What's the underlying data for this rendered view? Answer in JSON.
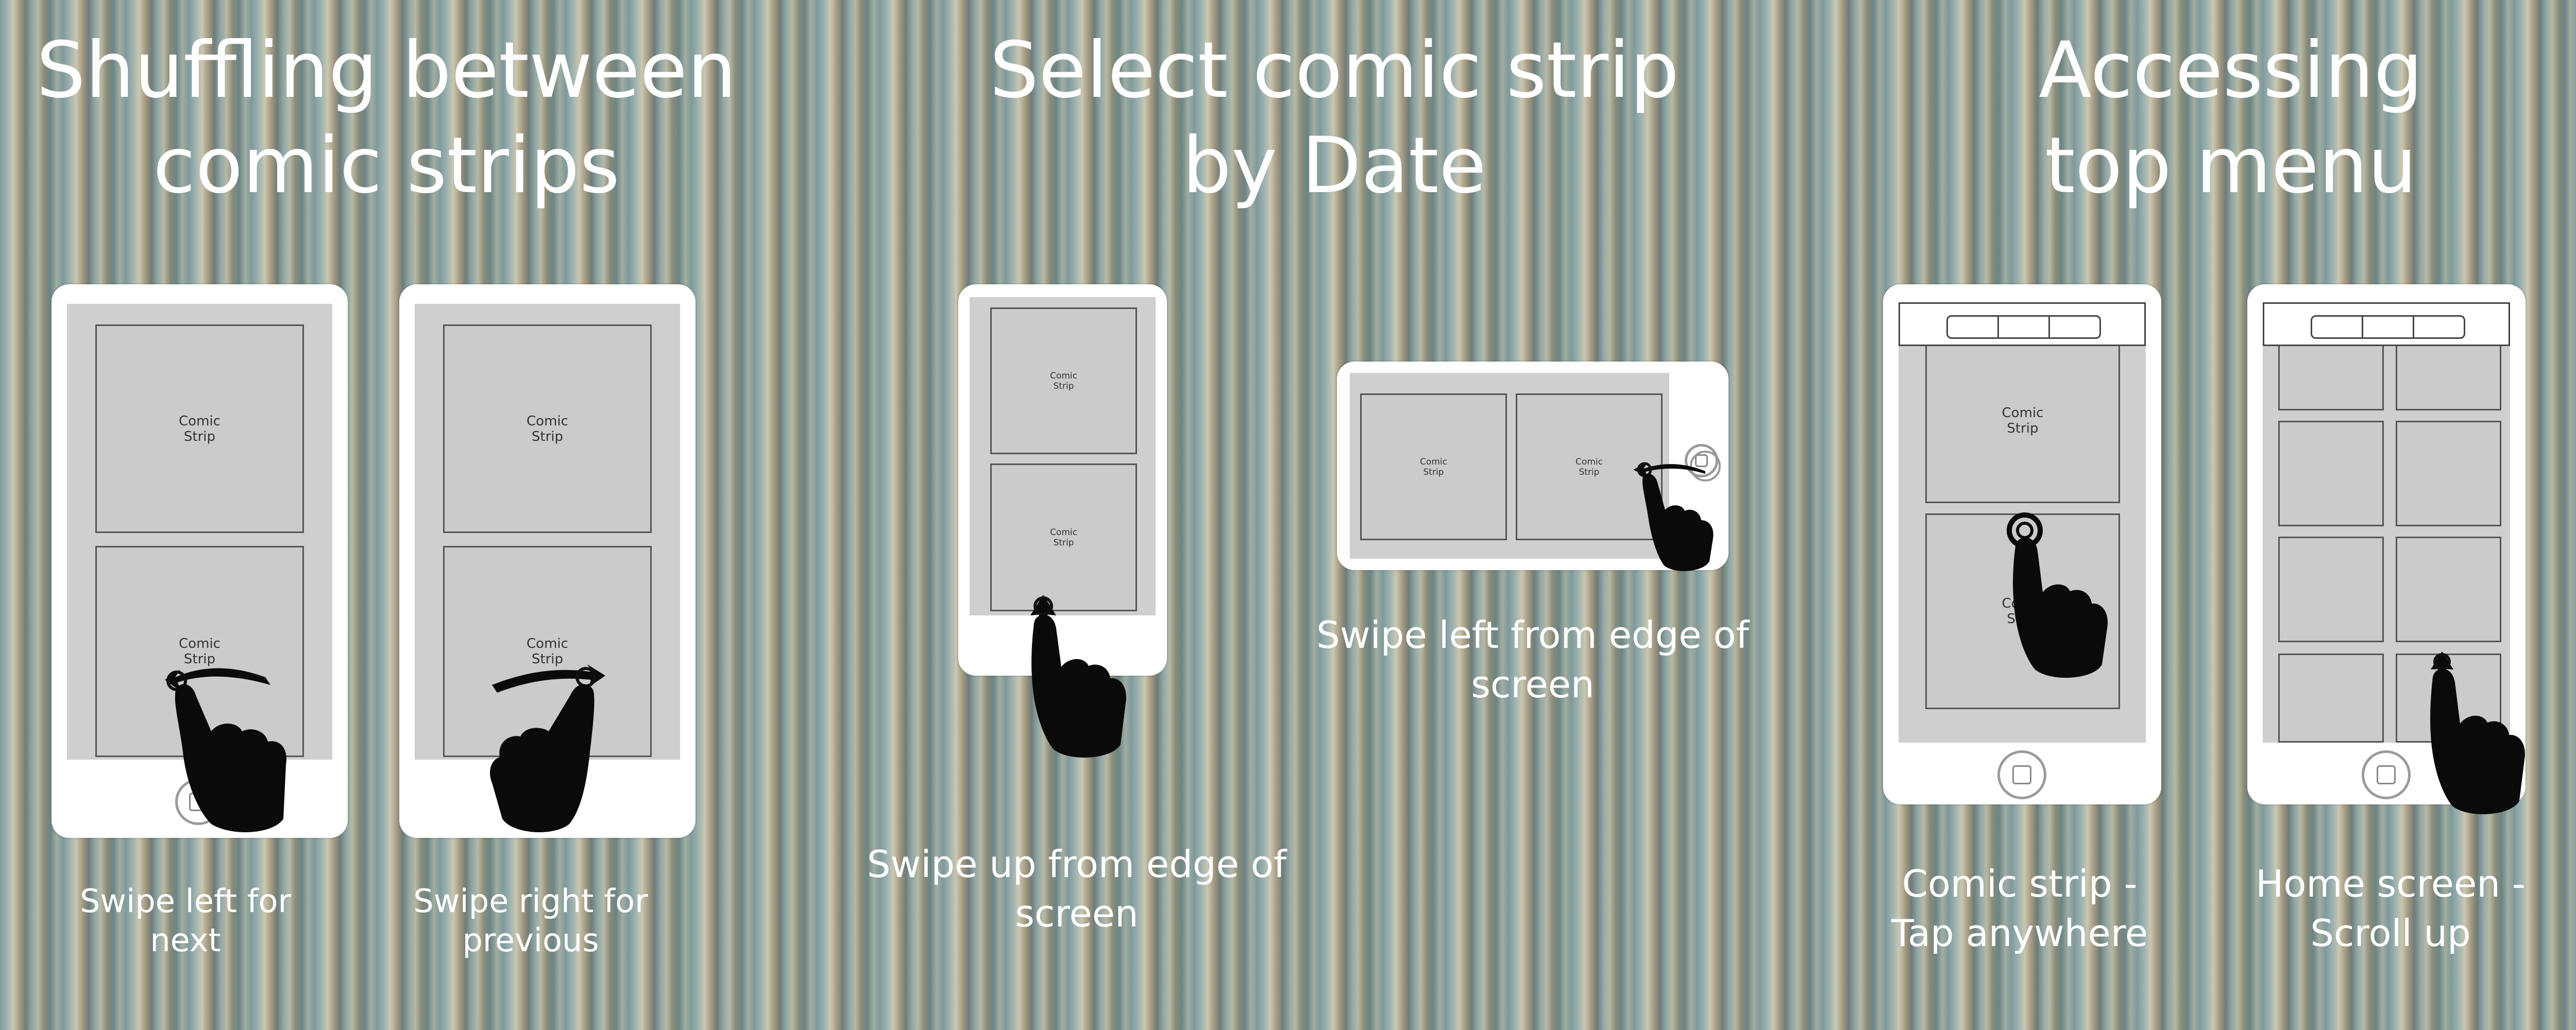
{
  "sections": {
    "shuffle": {
      "title": "Shuffling between\ncomic strips",
      "caption_left": "Swipe left for\nnext",
      "caption_right": "Swipe right for\nprevious"
    },
    "select": {
      "title": "Select comic strip\nby Date",
      "caption_up": "Swipe up from edge of\nscreen",
      "caption_left": "Swipe left from edge of\nscreen"
    },
    "menu": {
      "title": "Accessing\ntop menu",
      "caption_comic": "Comic strip -\nTap anywhere",
      "caption_home": "Home screen -\nScroll up"
    }
  },
  "strip_label": "Comic\nStrip",
  "colors": {
    "text": "#ffffff",
    "phone": "#ffffff",
    "screen": "#cfcfcf",
    "hand": "#0a0a0a",
    "outline": "#444444"
  },
  "icons": [
    "hand-swipe-left-icon",
    "hand-swipe-right-icon",
    "hand-swipe-up-icon",
    "hand-tap-icon",
    "home-button-icon"
  ]
}
